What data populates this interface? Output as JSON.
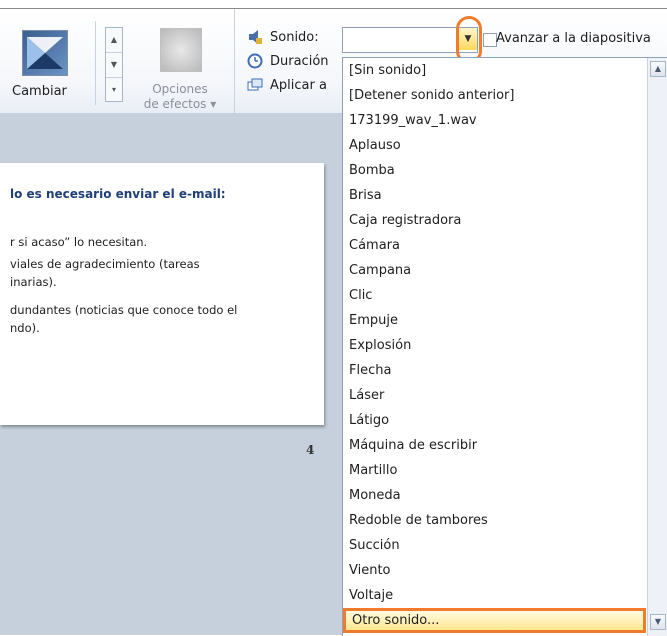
{
  "ribbon": {
    "change_label": "Cambiar",
    "effects_label_line1": "Opciones",
    "effects_label_line2": "de efectos ▾",
    "sound_label": "Sonido:",
    "duration_label": "Duración",
    "apply_label": "Aplicar a",
    "sound_value": "",
    "advance_label": "Avanzar a la diapositiva"
  },
  "slide": {
    "title": "lo es necesario enviar el e-mail:",
    "lines": [
      "r si acaso” lo necesitan.",
      "viales de agradecimiento (tareas",
      "inarias).",
      "dundantes (noticias que conoce todo el",
      "ndo)."
    ],
    "page_number": "4"
  },
  "sound_options": [
    "[Sin sonido]",
    "[Detener sonido anterior]",
    "173199_wav_1.wav",
    "Aplauso",
    "Bomba",
    "Brisa",
    "Caja registradora",
    "Cámara",
    "Campana",
    "Clic",
    "Empuje",
    "Explosión",
    "Flecha",
    "Láser",
    "Látigo",
    "Máquina de escribir",
    "Martillo",
    "Moneda",
    "Redoble de tambores",
    "Succión",
    "Viento",
    "Voltaje",
    "Otro sonido..."
  ],
  "selected_option": "Otro sonido...",
  "colors": {
    "highlight": "#f07b2c",
    "selection": "#ffe78f",
    "slide_title": "#1f3f7a"
  },
  "icons": {
    "sound": "speaker-icon",
    "duration": "clock-icon",
    "apply": "apply-all-icon"
  }
}
